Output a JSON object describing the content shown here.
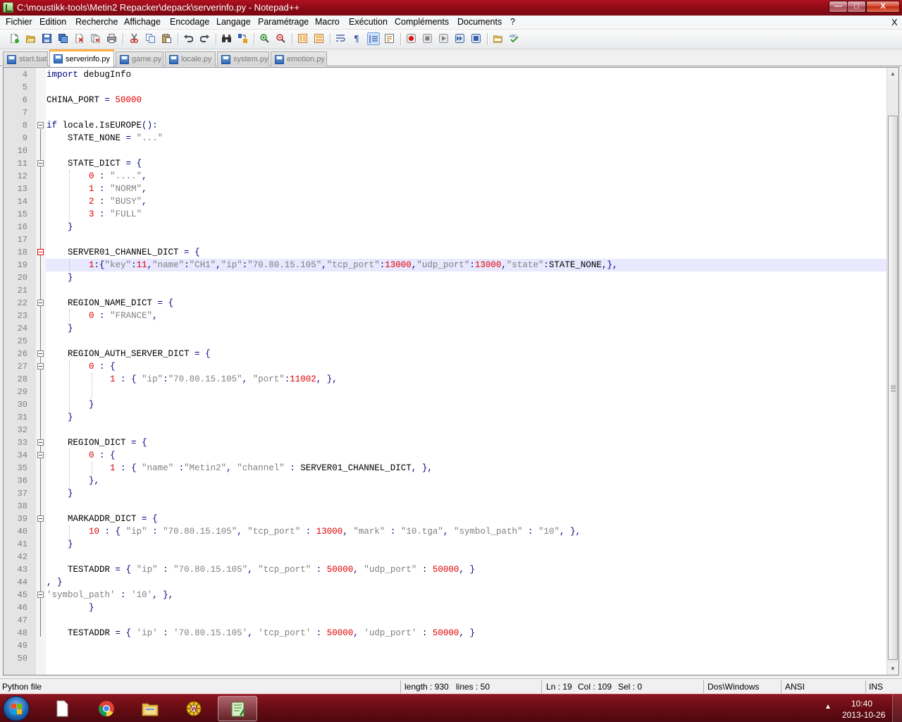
{
  "window": {
    "title": "C:\\moustikk-tools\\Metin2 Repacker\\depack\\serverinfo.py - Notepad++",
    "minimize_glyph": "—",
    "maximize_glyph": "□",
    "close_glyph": "X"
  },
  "menu": [
    "Fichier",
    "Edition",
    "Recherche",
    "Affichage",
    "Encodage",
    "Langage",
    "Paramétrage",
    "Macro",
    "Exécution",
    "Compléments",
    "Documents",
    "?"
  ],
  "menu_close": "X",
  "toolbar_icons": [
    "new-file-icon",
    "open-file-icon",
    "save-icon",
    "save-all-icon",
    "close-icon",
    "close-all-icon",
    "print-icon",
    "cut-icon",
    "copy-icon",
    "paste-icon",
    "undo-icon",
    "redo-icon",
    "find-icon",
    "replace-icon",
    "zoom-in-icon",
    "zoom-out-icon",
    "sync-vertical-icon",
    "sync-horizontal-icon",
    "word-wrap-icon",
    "show-all-chars-icon",
    "indent-guide-icon",
    "user-language-icon",
    "record-macro-icon",
    "stop-macro-icon",
    "play-macro-icon",
    "run-macro-multiple-icon",
    "save-macro-icon",
    "open-folder-icon",
    "spellcheck-icon"
  ],
  "tabs": [
    {
      "label": "start.bat",
      "active": false
    },
    {
      "label": "serverinfo.py",
      "active": true
    },
    {
      "label": "game.py",
      "active": false
    },
    {
      "label": "locale.py",
      "active": false
    },
    {
      "label": "system.py",
      "active": false
    },
    {
      "label": "emotion.py",
      "active": false
    }
  ],
  "editor": {
    "current_line": 19,
    "lines": [
      {
        "n": "4",
        "text": "import debugInfo"
      },
      {
        "n": "5",
        "text": ""
      },
      {
        "n": "6",
        "text": "CHINA_PORT = 50000"
      },
      {
        "n": "7",
        "text": ""
      },
      {
        "n": "8",
        "text": "if locale.IsEUROPE():"
      },
      {
        "n": "9",
        "text": "    STATE_NONE = \"...\""
      },
      {
        "n": "10",
        "text": ""
      },
      {
        "n": "11",
        "text": "    STATE_DICT = {"
      },
      {
        "n": "12",
        "text": "        0 : \"....\","
      },
      {
        "n": "13",
        "text": "        1 : \"NORM\","
      },
      {
        "n": "14",
        "text": "        2 : \"BUSY\","
      },
      {
        "n": "15",
        "text": "        3 : \"FULL\""
      },
      {
        "n": "16",
        "text": "    }"
      },
      {
        "n": "17",
        "text": ""
      },
      {
        "n": "18",
        "text": "    SERVER01_CHANNEL_DICT = {"
      },
      {
        "n": "19",
        "text": "        1:{\"key\":11,\"name\":\"CH1\",\"ip\":\"70.80.15.105\",\"tcp_port\":13000,\"udp_port\":13000,\"state\":STATE_NONE,},"
      },
      {
        "n": "20",
        "text": "    }"
      },
      {
        "n": "21",
        "text": ""
      },
      {
        "n": "22",
        "text": "    REGION_NAME_DICT = {"
      },
      {
        "n": "23",
        "text": "        0 : \"FRANCE\","
      },
      {
        "n": "24",
        "text": "    }"
      },
      {
        "n": "25",
        "text": ""
      },
      {
        "n": "26",
        "text": "    REGION_AUTH_SERVER_DICT = {"
      },
      {
        "n": "27",
        "text": "        0 : {"
      },
      {
        "n": "28",
        "text": "            1 : { \"ip\":\"70.80.15.105\", \"port\":11002, },"
      },
      {
        "n": "29",
        "text": ""
      },
      {
        "n": "30",
        "text": "        }"
      },
      {
        "n": "31",
        "text": "    }"
      },
      {
        "n": "32",
        "text": ""
      },
      {
        "n": "33",
        "text": "    REGION_DICT = {"
      },
      {
        "n": "34",
        "text": "        0 : {"
      },
      {
        "n": "35",
        "text": "            1 : { \"name\" :\"Metin2\", \"channel\" : SERVER01_CHANNEL_DICT, },"
      },
      {
        "n": "36",
        "text": "        },"
      },
      {
        "n": "37",
        "text": "    }"
      },
      {
        "n": "38",
        "text": ""
      },
      {
        "n": "39",
        "text": "    MARKADDR_DICT = {"
      },
      {
        "n": "40",
        "text": "        10 : { \"ip\" : \"70.80.15.105\", \"tcp_port\" : 13000, \"mark\" : \"10.tga\", \"symbol_path\" : \"10\", },"
      },
      {
        "n": "41",
        "text": "    }"
      },
      {
        "n": "42",
        "text": ""
      },
      {
        "n": "43",
        "text": "    TESTADDR = { \"ip\" : \"70.80.15.105\", \"tcp_port\" : 50000, \"udp_port\" : 50000, }"
      },
      {
        "n": "44",
        "text": ", }"
      },
      {
        "n": "45",
        "text": "'symbol_path' : '10', },"
      },
      {
        "n": "46",
        "text": "        }"
      },
      {
        "n": "47",
        "text": ""
      },
      {
        "n": "48",
        "text": "    TESTADDR = { 'ip' : '70.80.15.105', 'tcp_port' : 50000, 'udp_port' : 50000, }"
      },
      {
        "n": "49",
        "text": ""
      },
      {
        "n": "50",
        "text": ""
      }
    ]
  },
  "status": {
    "filetype": "Python file",
    "length": "length : 930",
    "lines": "lines : 50",
    "ln": "Ln : 19",
    "col": "Col : 109",
    "sel": "Sel : 0",
    "eol": "Dos\\Windows",
    "encoding": "ANSI",
    "mode": "INS"
  },
  "taskbar": {
    "apps": [
      "blank-document-icon",
      "chrome-icon",
      "file-explorer-icon",
      "wamp-server-icon",
      "notepad-plus-plus-icon"
    ],
    "tray_arrow": "▲",
    "time": "10:40",
    "date": "2013-10-26"
  }
}
